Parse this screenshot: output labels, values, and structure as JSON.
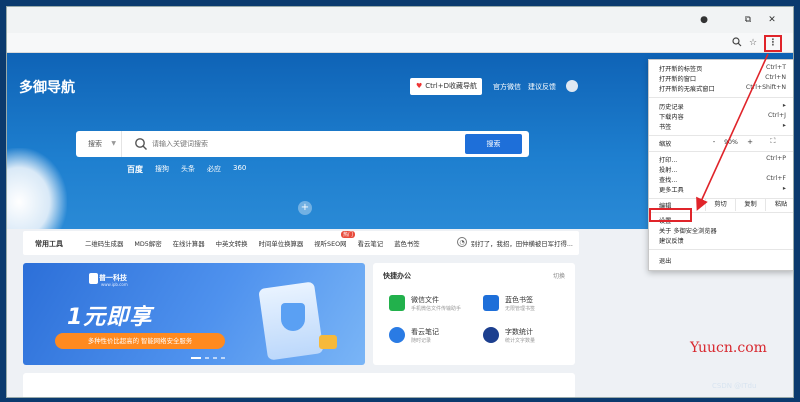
{
  "window_controls": {
    "record": "●",
    "restore": "⧉",
    "close": "✕"
  },
  "addressbar": {
    "zoom_icon": "zoom-icon",
    "star_icon": "star-icon",
    "menu_icon": "⋮"
  },
  "header": {
    "logo": "多御导航",
    "fav_button": "Ctrl+D收藏导航",
    "links": [
      "官方微信",
      "建议反馈"
    ]
  },
  "search": {
    "engine": "搜索",
    "placeholder": "请输入关键词搜索",
    "button": "搜索",
    "engines": [
      "百度",
      "搜狗",
      "头条",
      "必应",
      "360"
    ]
  },
  "tools": {
    "title": "常用工具",
    "items": [
      "二维码生成器",
      "MD5解密",
      "在线计算器",
      "中英文转换",
      "时间单位换算器",
      "视听SEO网",
      "看云笔记",
      "蓝色书签"
    ],
    "hot_badge": "热门",
    "notice": "别打了，我招，田仲横被日军打得..."
  },
  "banner": {
    "brand": "普一科技",
    "brand_sub": "www.ipb.com",
    "title": "1元即享",
    "tagline": "多种性价比超高的 智能网络安全服务"
  },
  "quick_office": {
    "title": "快捷办公",
    "switch": "切换",
    "items": [
      {
        "name": "微信文件",
        "desc": "手机微信文件传输助手",
        "color": "#22b14c"
      },
      {
        "name": "蓝色书签",
        "desc": "无限管理书签",
        "color": "#1e6fd9"
      },
      {
        "name": "看云笔记",
        "desc": "随时记录",
        "color": "#2a7be4"
      },
      {
        "name": "字数统计",
        "desc": "统计文字数量",
        "color": "#1c3f8f"
      }
    ]
  },
  "menu": {
    "items": [
      {
        "label": "打开新的标签页",
        "shortcut": "Ctrl+T"
      },
      {
        "label": "打开新的窗口",
        "shortcut": "Ctrl+N"
      },
      {
        "label": "打开新的无痕式窗口",
        "shortcut": "Ctrl+Shift+N"
      },
      {
        "label": "历史记录",
        "shortcut": "▸"
      },
      {
        "label": "下载内容",
        "shortcut": "Ctrl+J"
      },
      {
        "label": "书签",
        "shortcut": "▸"
      },
      {
        "label": "缩放",
        "shortcut": ""
      },
      {
        "label": "打印...",
        "shortcut": "Ctrl+P"
      },
      {
        "label": "投射...",
        "shortcut": ""
      },
      {
        "label": "查找...",
        "shortcut": "Ctrl+F"
      },
      {
        "label": "更多工具",
        "shortcut": "▸"
      },
      {
        "label": "编辑",
        "shortcut": ""
      },
      {
        "label": "设置",
        "shortcut": ""
      },
      {
        "label": "关于 多御安全浏览器",
        "shortcut": ""
      },
      {
        "label": "建议反馈",
        "shortcut": ""
      },
      {
        "label": "退出",
        "shortcut": ""
      }
    ],
    "zoom": {
      "minus": "-",
      "value": "90%",
      "plus": "+",
      "fullscreen": "⛶"
    },
    "edit": {
      "cut": "剪切",
      "copy": "复制",
      "paste": "粘贴"
    }
  },
  "watermarks": {
    "site": "Yuucn.com",
    "csdn": "CSDN @ITdu"
  },
  "colors": {
    "accent": "#1e6fd9",
    "highlight": "#e0242a",
    "hero": "#1670c3"
  }
}
